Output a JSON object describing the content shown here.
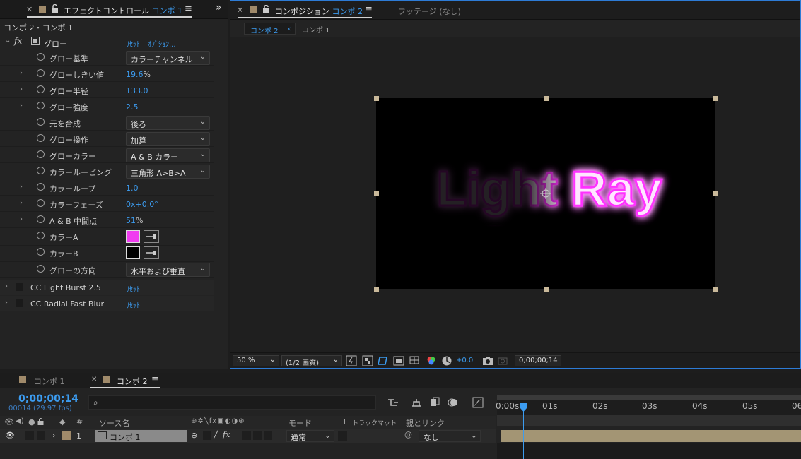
{
  "effect_controls": {
    "tab_title": "エフェクトコントロール",
    "tab_comp": "コンポ 1",
    "breadcrumb": "コンポ 2・コンポ 1",
    "effect_name": "グロー",
    "fx_label": "fx",
    "reset": "ﾘｾｯﾄ",
    "options": "ｵﾌﾟｼｮﾝ...",
    "props": [
      {
        "label": "グロー基準",
        "dropdown": "カラーチャンネル"
      },
      {
        "label": "グローしきい値",
        "value": "19.6",
        "unit": "%"
      },
      {
        "label": "グロー半径",
        "value": "133.0"
      },
      {
        "label": "グロー強度",
        "value": "2.5"
      },
      {
        "label": "元を合成",
        "dropdown": "後ろ"
      },
      {
        "label": "グロー操作",
        "dropdown": "加算"
      },
      {
        "label": "グローカラー",
        "dropdown": "A & B カラー"
      },
      {
        "label": "カラールーピング",
        "dropdown": "三角形 A>B>A"
      },
      {
        "label": "カラーループ",
        "value": "1.0"
      },
      {
        "label": "カラーフェーズ",
        "value": "0x+0.0°"
      },
      {
        "label": "A & B 中間点",
        "value": "51",
        "unit": "%"
      },
      {
        "label": "カラーA"
      },
      {
        "label": "カラーB"
      },
      {
        "label": "グローの方向",
        "dropdown": "水平および垂直"
      }
    ],
    "color_a": "#f03cf0",
    "color_b": "#000000",
    "other_effects": [
      {
        "name": "CC Light Burst 2.5",
        "reset": "ﾘｾｯﾄ"
      },
      {
        "name": "CC Radial Fast Blur",
        "reset": "ﾘｾｯﾄ"
      }
    ]
  },
  "composition": {
    "tab_title": "コンポジション",
    "tab_comp": "コンポ 2",
    "footage_tab": "フッテージ (なし)",
    "breadcrumb_active": "コンポ 2",
    "breadcrumb_other": "コンポ 1",
    "canvas_text": "Light Ray",
    "glow_color": "#ff33ff",
    "toolbar": {
      "zoom": "50 %",
      "resolution": "(1/2 画質)",
      "exposure": "+0.0",
      "timecode": "0;00;00;14"
    }
  },
  "timeline": {
    "tabs": [
      "コンポ 1",
      "コンポ 2"
    ],
    "current_time": "0;00;00;14",
    "frame_info": "00014 (29.97 fps)",
    "search_placeholder": "",
    "headers": {
      "num": "#",
      "source": "ソース名",
      "mode": "モード",
      "t": "T",
      "trackmatte": "トラックマット",
      "parent": "親とリンク"
    },
    "layer": {
      "num": "1",
      "name": "コンポ 1",
      "mode": "通常",
      "parent": "なし"
    },
    "ruler": [
      "0:00s",
      "01s",
      "02s",
      "03s",
      "04s",
      "05s",
      "06"
    ]
  }
}
